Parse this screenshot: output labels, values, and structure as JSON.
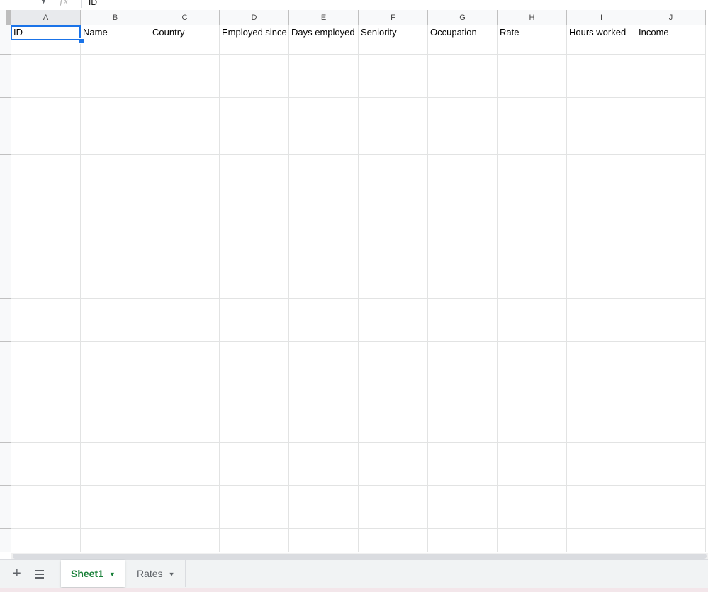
{
  "formula_bar": {
    "fx_icon": "fx-icon",
    "value": "ID"
  },
  "columns": [
    "A",
    "B",
    "C",
    "D",
    "E",
    "F",
    "G",
    "H",
    "I",
    "J"
  ],
  "selected_column": "A",
  "header_row": [
    "ID",
    "Name",
    "Country",
    "Employed since",
    "Days employed",
    "Seniority",
    "Occupation",
    "Rate",
    "Hours worked",
    "Income"
  ],
  "sheets": {
    "add_icon": "plus-icon",
    "list_icon": "sheet-list-icon",
    "tabs": [
      {
        "label": "Sheet1",
        "active": true
      },
      {
        "label": "Rates",
        "active": false
      }
    ]
  },
  "colors": {
    "selection": "#1a73e8",
    "active_tab_text": "#188038",
    "grid_line": "#e2e3e3"
  }
}
